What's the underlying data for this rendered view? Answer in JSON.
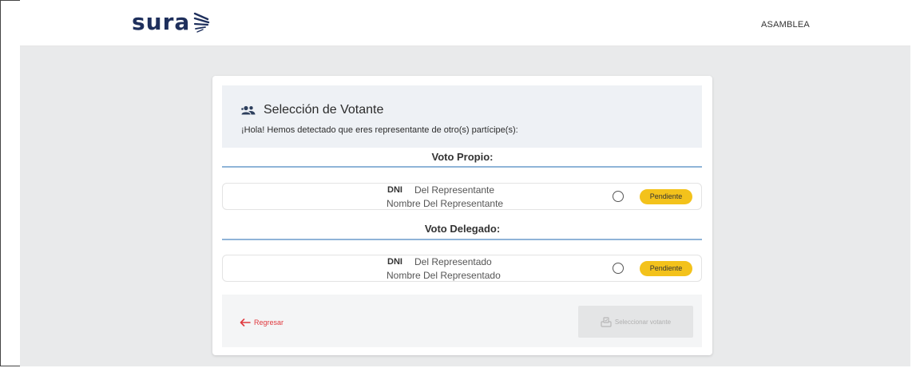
{
  "header": {
    "logo_text": "sura",
    "nav_link": "ASAMBLEA"
  },
  "card": {
    "title": "Selección de Votante",
    "subtitle": "¡Hola! Hemos detectado que eres representante de otro(s) partícipe(s):",
    "sections": [
      {
        "title": "Voto Propio:",
        "row": {
          "dni_label": "DNI",
          "line1": "Del Representante",
          "line2": "Nombre Del Representante",
          "status": "Pendiente"
        }
      },
      {
        "title": "Voto Delegado:",
        "row": {
          "dni_label": "DNI",
          "line1": "Del Representado",
          "line2": "Nombre Del Representado",
          "status": "Pendiente"
        }
      }
    ],
    "back_label": "Regresar",
    "select_label": "Seleccionar votante"
  },
  "colors": {
    "brand": "#1e2f5c",
    "status_pending": "#f3c21b",
    "back_link": "#e0393e",
    "divider": "#8fb4d8",
    "backdrop": "#e9eaeb"
  },
  "icons": {
    "logo": "sura-wing-logo",
    "title": "people-icon",
    "back": "arrow-left-icon",
    "select": "ballot-box-icon"
  }
}
